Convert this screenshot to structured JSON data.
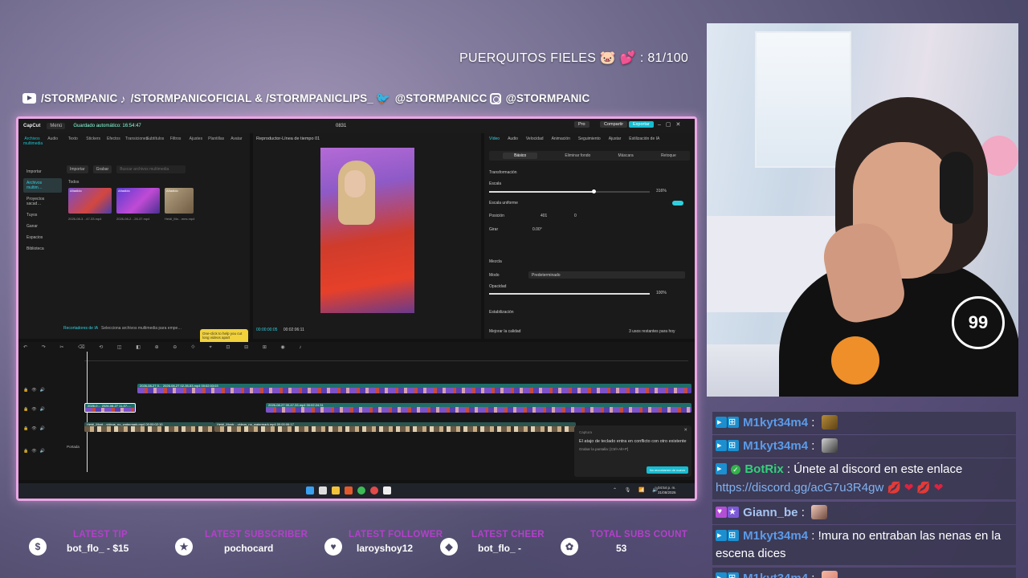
{
  "overlay": {
    "sub_goal": "PUERQUITOS FIELES 🐷 💕 : 81/100",
    "socials": {
      "youtube": "/STORMPANIC",
      "tiktok": "/STORMPANICOFICIAL & /STORMPANICLIPS_",
      "twitter": "@STORMPANICC",
      "instagram": "@STORMPANIC"
    }
  },
  "app": {
    "name": "CapCut",
    "menu_label": "Menú",
    "autosave": "Guardado automático: 16:54:47",
    "project_title": "0831",
    "pro_label": "Pro",
    "share_label": "Compartir",
    "export_label": "Exportar",
    "media_tools": [
      "Archivos multimedia",
      "Audio",
      "Texto",
      "Stickers",
      "Efectos",
      "Transiciones",
      "Subtítulos",
      "Filtros",
      "Ajustes",
      "Plantillas",
      "Avatar"
    ],
    "media_sidebar": [
      "Importar",
      "Archivos multim…",
      "Proyectos sacad…",
      "Tuyos",
      "Ganar",
      "Espacios",
      "Biblioteca"
    ],
    "import_label": "Importar",
    "record_label": "Grabar",
    "search_placeholder": "Buscar archivos multimedia",
    "todos_label": "Todos",
    "clips": [
      {
        "tag": "Añadido",
        "name": "2026-08-3…47-33.mp4"
      },
      {
        "tag": "Añadido",
        "name": "2026-08-2…26-37.mp4"
      },
      {
        "tag": "Añadido",
        "duration": "00:12",
        "name": "Heidi_Mo…mes.mp4"
      }
    ],
    "ai_recorder": "Recortadores de IA",
    "ai_hint": "Selecciona archivos multimedia para empe…",
    "tooltip_text": "One-click to help you cut long videos apart",
    "tooltip_ok": "OK",
    "player_title": "Reproductor-Línea de tiempo 01",
    "time_current": "00:00:00:05",
    "time_total": "00:02:06:11",
    "prop_tabs": [
      "Vídeo",
      "Audio",
      "Velocidad",
      "Animación",
      "Seguimiento",
      "Ajustar",
      "Estilización de IA"
    ],
    "prop_subtabs": [
      "Básico",
      "Eliminar fondo",
      "Máscara",
      "Retoque"
    ],
    "transform_label": "Transformación",
    "scale_label": "Escala",
    "scale_value": "316%",
    "scale_level": 0.65,
    "uniform_scale_label": "Escala uniforme",
    "position_label": "Posición",
    "pos_x": "401",
    "pos_y": "0",
    "rotate_label": "Girar",
    "rotate_value": "0.00°",
    "blend_label": "Mezcla",
    "mode_label": "Modo",
    "mode_value": "Predeterminado",
    "opacity_label": "Opacidad",
    "opacity_value": "100%",
    "stabilize_label": "Estabilización",
    "quality_label": "Mejorar la calidad",
    "uses_left": "3 usos restantes para hoy",
    "tracks": [
      {
        "label": "2026-08-27 0…  2026-08-27 02-35-53.mp4  00:02:03:03"
      },
      {
        "label": "2026-0…  2026-08-27 11-07-…"
      },
      {
        "label": "2026-08-27 00-47-33.mp4  00:02:24:31"
      },
      {
        "label": "Heidi_Mont…videos_no_watermark.mp4  00:00:02:10"
      },
      {
        "label": "Heidi_Montr…videos_no_watermark.mp4  00:00:06:17"
      }
    ],
    "portada_label": "Portada",
    "conflict_title": "Captura",
    "conflict_text": "El atajo de teclado entra en conflicto con otro existente",
    "conflict_sub": "Grabar la pantalla: [Ctrl+Alt+P]",
    "conflict_btn": "No recordarme de nuevo",
    "clock_time": "04:54 p. m.",
    "clock_date": "31/08/2026"
  },
  "chat": [
    {
      "user": "M1kyt34m4",
      "badges": [
        "prime",
        "game"
      ],
      "text": "",
      "emote": "e1"
    },
    {
      "user": "M1kyt34m4",
      "badges": [
        "prime",
        "game"
      ],
      "text": "",
      "emote": "e2"
    },
    {
      "user": "BotRix",
      "badges": [
        "prime",
        "check"
      ],
      "text": "Únete al discord en este enlace",
      "link": "https://discord.gg/acG7u3R4gw",
      "hearts": "💋 ❤ 💋 ❤"
    },
    {
      "user": "Giann_be",
      "badges": [
        "heart",
        "star"
      ],
      "text": "",
      "emote": "e3"
    },
    {
      "user": "M1kyt34m4",
      "badges": [
        "prime",
        "game"
      ],
      "text": "!mura no entraban las nenas en la escena dices"
    },
    {
      "user": "M1kyt34m4",
      "badges": [
        "prime",
        "game"
      ],
      "text": "",
      "emote": "e4"
    }
  ],
  "stats": [
    {
      "title": "LATEST TIP",
      "value": "bot_flo_ - $15",
      "icon": "dollar-icon"
    },
    {
      "title": "LATEST SUBSCRIBER",
      "value": "pochocard",
      "icon": "star-icon"
    },
    {
      "title": "LATEST FOLLOWER",
      "value": "laroyshoy12",
      "icon": "heart-icon"
    },
    {
      "title": "LATEST CHEER",
      "value": "bot_flo_ -",
      "icon": "gem-icon"
    },
    {
      "title": "TOTAL SUBS COUNT",
      "value": "53",
      "icon": "paw-icon"
    }
  ]
}
